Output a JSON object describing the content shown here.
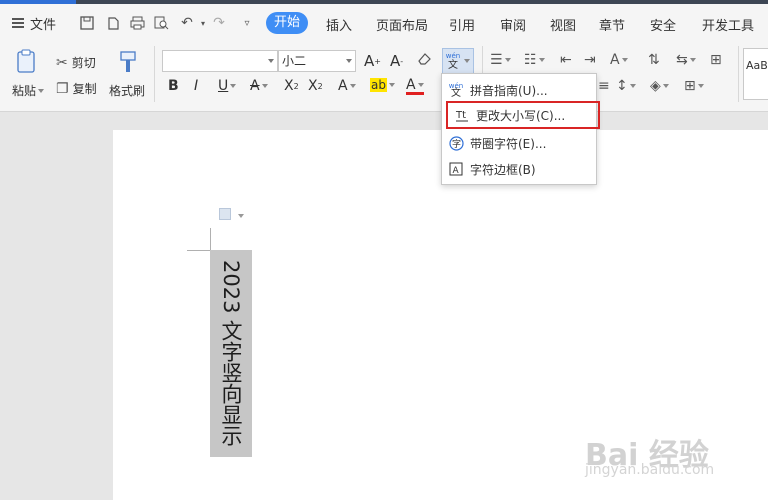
{
  "menubar": {
    "file_label": "文件",
    "tabs": [
      "开始",
      "插入",
      "页面布局",
      "引用",
      "审阅",
      "视图",
      "章节",
      "安全",
      "开发工具"
    ]
  },
  "ribbon": {
    "paste_label": "粘贴",
    "cut_label": "剪切",
    "copy_label": "复制",
    "format_painter_label": "格式刷",
    "font_name": "",
    "font_size": "小二",
    "pinyin_icon_top": "wén",
    "pinyin_icon_bottom": "文",
    "styles_preview": "AaB"
  },
  "dropdown": {
    "items": [
      {
        "label": "拼音指南(U)...",
        "icon": "pinyin-icon"
      },
      {
        "label": "更改大小写(C)...",
        "icon": "change-case-icon"
      },
      {
        "label": "带圈字符(E)...",
        "icon": "enclosed-char-icon"
      },
      {
        "label": "字符边框(B)",
        "icon": "char-border-icon"
      }
    ],
    "highlight_color": "#d92525"
  },
  "document": {
    "vertical_text": "2023 文字竖向显示"
  },
  "watermark": {
    "main": "Bai 经验",
    "sub": "jingyan.baidu.com"
  },
  "colors": {
    "accent": "#3f8ef5",
    "ribbon_bg": "#f5f5f5",
    "workspace_bg": "#e6e6e6"
  }
}
